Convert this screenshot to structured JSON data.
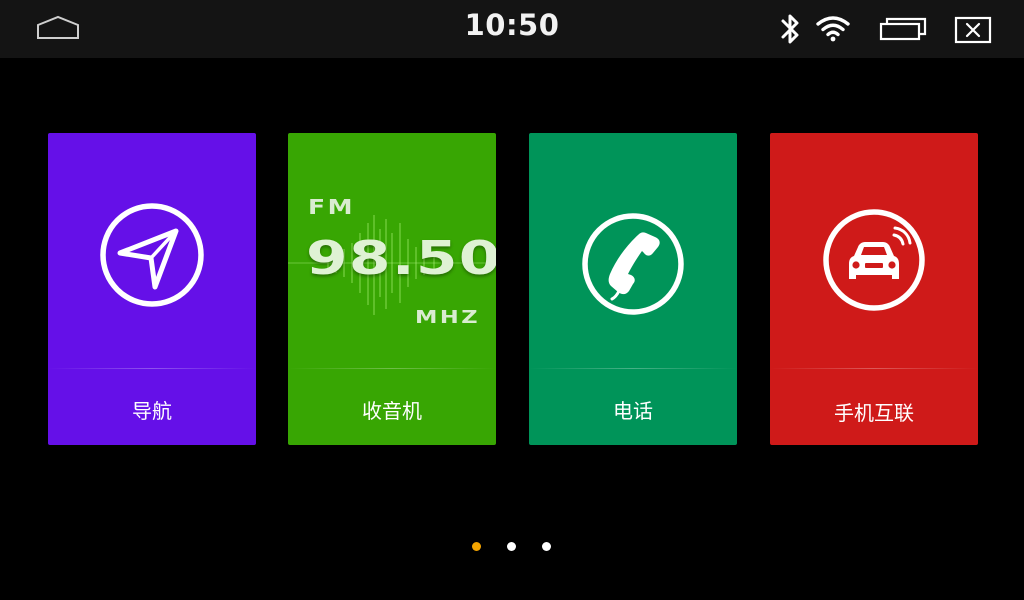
{
  "statusbar": {
    "time": "10:50",
    "icons": [
      "home-icon",
      "bluetooth-icon",
      "wifi-icon",
      "recent-apps-icon",
      "close-icon"
    ]
  },
  "tiles": [
    {
      "label": "导航",
      "color": "#6510e8",
      "icon": "navigation-icon"
    },
    {
      "label": "收音机",
      "color": "#38a603",
      "icon": "radio-icon",
      "radio": {
        "band": "FM",
        "frequency": "98.50",
        "unit": "MHZ"
      }
    },
    {
      "label": "电话",
      "color": "#009459",
      "icon": "phone-icon"
    },
    {
      "label": "手机互联",
      "color": "#cf1a19",
      "icon": "car-connect-icon"
    }
  ],
  "pager": {
    "total": 3,
    "active_index": 0,
    "active_color": "#f5a500",
    "inactive_color": "#ffffff"
  }
}
